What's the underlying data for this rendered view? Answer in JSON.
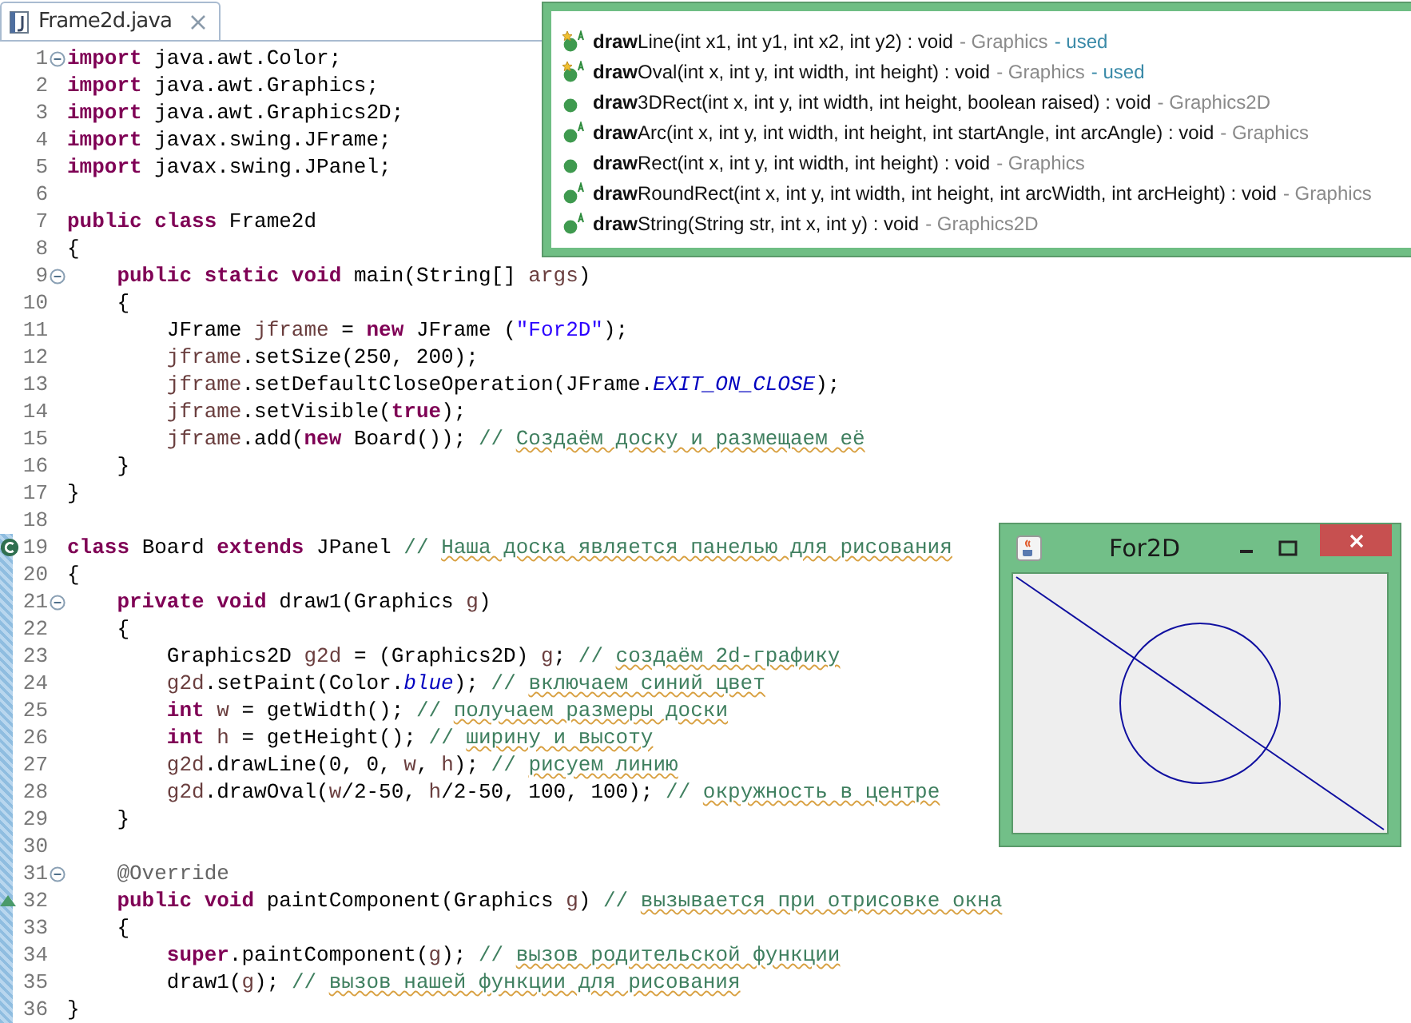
{
  "tab": {
    "label": "Frame2d.java",
    "selected": true
  },
  "lines": [
    {
      "number": "1",
      "kind": "fold",
      "range": false,
      "tokens": [
        {
          "kind": "kw",
          "text": "import"
        },
        {
          "kind": "p",
          "text": " java.awt.Color;"
        }
      ]
    },
    {
      "number": "2",
      "range": false,
      "tokens": [
        {
          "kind": "kw",
          "text": "import"
        },
        {
          "kind": "p",
          "text": " java.awt.Graphics;"
        }
      ]
    },
    {
      "number": "3",
      "range": false,
      "tokens": [
        {
          "kind": "kw",
          "text": "import"
        },
        {
          "kind": "p",
          "text": " java.awt.Graphics2D;"
        }
      ]
    },
    {
      "number": "4",
      "range": false,
      "tokens": [
        {
          "kind": "kw",
          "text": "import"
        },
        {
          "kind": "p",
          "text": " javax.swing.JFrame;"
        }
      ]
    },
    {
      "number": "5",
      "range": false,
      "tokens": [
        {
          "kind": "kw",
          "text": "import"
        },
        {
          "kind": "p",
          "text": " javax.swing.JPanel;"
        }
      ]
    },
    {
      "number": "6",
      "range": false
    },
    {
      "number": "7",
      "range": false,
      "tokens": [
        {
          "kind": "kw",
          "text": "public class"
        },
        {
          "kind": "p",
          "text": " Frame2d"
        }
      ]
    },
    {
      "number": "8",
      "range": false,
      "tokens": [
        {
          "kind": "p",
          "text": "{"
        }
      ]
    },
    {
      "number": "9",
      "kind": "fold",
      "range": false,
      "tokens": [
        {
          "kind": "kw",
          "text": "    public static void"
        },
        {
          "kind": "p",
          "text": " main(String[] "
        },
        {
          "kind": "v",
          "text": "args"
        },
        {
          "kind": "p",
          "text": ")"
        }
      ]
    },
    {
      "number": "10",
      "range": false,
      "tokens": [
        {
          "kind": "p",
          "text": "    {"
        }
      ]
    },
    {
      "number": "11",
      "range": false,
      "tokens": [
        {
          "kind": "p",
          "text": "        JFrame "
        },
        {
          "kind": "v",
          "text": "jframe"
        },
        {
          "kind": "p",
          "text": " = "
        },
        {
          "kind": "kw",
          "text": "new"
        },
        {
          "kind": "p",
          "text": " JFrame ("
        },
        {
          "kind": "s",
          "text": "\"For2D\""
        },
        {
          "kind": "p",
          "text": ");"
        }
      ]
    },
    {
      "number": "12",
      "range": false,
      "tokens": [
        {
          "kind": "v",
          "text": "        jframe"
        },
        {
          "kind": "p",
          "text": ".setSize(250, 200);"
        }
      ]
    },
    {
      "number": "13",
      "range": false,
      "tokens": [
        {
          "kind": "v",
          "text": "        jframe"
        },
        {
          "kind": "p",
          "text": ".setDefaultCloseOperation(JFrame."
        },
        {
          "kind": "c",
          "text": "EXIT_ON_CLOSE"
        },
        {
          "kind": "p",
          "text": ");"
        }
      ]
    },
    {
      "number": "14",
      "range": false,
      "tokens": [
        {
          "kind": "v",
          "text": "        jframe"
        },
        {
          "kind": "p",
          "text": ".setVisible("
        },
        {
          "kind": "kw",
          "text": "true"
        },
        {
          "kind": "p",
          "text": ");"
        }
      ]
    },
    {
      "number": "15",
      "range": false,
      "tokens": [
        {
          "kind": "v",
          "text": "        jframe"
        },
        {
          "kind": "p",
          "text": ".add("
        },
        {
          "kind": "kw",
          "text": "new"
        },
        {
          "kind": "p",
          "text": " Board()); "
        },
        {
          "kind": "cm",
          "text": "// "
        },
        {
          "kind": "sp",
          "text": "Создаём доску и размещаем её"
        }
      ]
    },
    {
      "number": "16",
      "range": false,
      "tokens": [
        {
          "kind": "p",
          "text": "    }"
        }
      ]
    },
    {
      "number": "17",
      "range": false,
      "tokens": [
        {
          "kind": "p",
          "text": "}"
        }
      ]
    },
    {
      "number": "18",
      "range": false
    },
    {
      "number": "19",
      "kind": "class",
      "range": true,
      "tokens": [
        {
          "kind": "kw",
          "text": "class"
        },
        {
          "kind": "p",
          "text": " Board "
        },
        {
          "kind": "kw",
          "text": "extends"
        },
        {
          "kind": "p",
          "text": " JPanel "
        },
        {
          "kind": "cm",
          "text": "// "
        },
        {
          "kind": "sp",
          "text": "Наша доска является панелью для рисования"
        }
      ]
    },
    {
      "number": "20",
      "range": true,
      "tokens": [
        {
          "kind": "p",
          "text": "{"
        }
      ]
    },
    {
      "number": "21",
      "kind": "fold",
      "range": true,
      "tokens": [
        {
          "kind": "kw",
          "text": "    private void"
        },
        {
          "kind": "p",
          "text": " draw1(Graphics "
        },
        {
          "kind": "v",
          "text": "g"
        },
        {
          "kind": "p",
          "text": ")"
        }
      ]
    },
    {
      "number": "22",
      "range": true,
      "tokens": [
        {
          "kind": "p",
          "text": "    {"
        }
      ]
    },
    {
      "number": "23",
      "range": true,
      "tokens": [
        {
          "kind": "p",
          "text": "        Graphics2D "
        },
        {
          "kind": "v",
          "text": "g2d"
        },
        {
          "kind": "p",
          "text": " = (Graphics2D) "
        },
        {
          "kind": "v",
          "text": "g"
        },
        {
          "kind": "p",
          "text": "; "
        },
        {
          "kind": "cm",
          "text": "// "
        },
        {
          "kind": "sp",
          "text": "создаём 2d-графику"
        }
      ]
    },
    {
      "number": "24",
      "range": true,
      "tokens": [
        {
          "kind": "v",
          "text": "        g2d"
        },
        {
          "kind": "p",
          "text": ".setPaint(Color."
        },
        {
          "kind": "c",
          "text": "blue"
        },
        {
          "kind": "p",
          "text": "); "
        },
        {
          "kind": "cm",
          "text": "// "
        },
        {
          "kind": "sp",
          "text": "включаем синий цвет"
        }
      ]
    },
    {
      "number": "25",
      "range": true,
      "tokens": [
        {
          "kind": "kw",
          "text": "        int"
        },
        {
          "kind": "v",
          "text": " w"
        },
        {
          "kind": "p",
          "text": " = getWidth(); "
        },
        {
          "kind": "cm",
          "text": "// "
        },
        {
          "kind": "sp",
          "text": "получаем размеры доски"
        }
      ]
    },
    {
      "number": "26",
      "range": true,
      "tokens": [
        {
          "kind": "kw",
          "text": "        int"
        },
        {
          "kind": "v",
          "text": " h"
        },
        {
          "kind": "p",
          "text": " = getHeight(); "
        },
        {
          "kind": "cm",
          "text": "// "
        },
        {
          "kind": "sp",
          "text": "ширину и высоту"
        }
      ]
    },
    {
      "number": "27",
      "range": true,
      "tokens": [
        {
          "kind": "v",
          "text": "        g2d"
        },
        {
          "kind": "p",
          "text": ".drawLine(0, 0, "
        },
        {
          "kind": "v",
          "text": "w"
        },
        {
          "kind": "p",
          "text": ", "
        },
        {
          "kind": "v",
          "text": "h"
        },
        {
          "kind": "p",
          "text": "); "
        },
        {
          "kind": "cm",
          "text": "// "
        },
        {
          "kind": "sp",
          "text": "рисуем линию"
        }
      ]
    },
    {
      "number": "28",
      "range": true,
      "tokens": [
        {
          "kind": "v",
          "text": "        g2d"
        },
        {
          "kind": "p",
          "text": ".drawOval("
        },
        {
          "kind": "v",
          "text": "w"
        },
        {
          "kind": "p",
          "text": "/2-50, "
        },
        {
          "kind": "v",
          "text": "h"
        },
        {
          "kind": "p",
          "text": "/2-50, 100, 100); "
        },
        {
          "kind": "cm",
          "text": "// "
        },
        {
          "kind": "sp",
          "text": "окружность в центре"
        }
      ]
    },
    {
      "number": "29",
      "range": true,
      "tokens": [
        {
          "kind": "p",
          "text": "    }"
        }
      ]
    },
    {
      "number": "30",
      "range": true
    },
    {
      "number": "31",
      "kind": "fold",
      "range": true,
      "tokens": [
        {
          "kind": "an",
          "text": "    @Override"
        }
      ]
    },
    {
      "number": "32",
      "kind": "override",
      "range": true,
      "tokens": [
        {
          "kind": "kw",
          "text": "    public void"
        },
        {
          "kind": "p",
          "text": " paintComponent(Graphics "
        },
        {
          "kind": "v",
          "text": "g"
        },
        {
          "kind": "p",
          "text": ") "
        },
        {
          "kind": "cm",
          "text": "// "
        },
        {
          "kind": "sp",
          "text": "вызывается при отрисовке окна"
        }
      ]
    },
    {
      "number": "33",
      "range": true,
      "tokens": [
        {
          "kind": "p",
          "text": "    {"
        }
      ]
    },
    {
      "number": "34",
      "range": true,
      "tokens": [
        {
          "kind": "kw",
          "text": "        super"
        },
        {
          "kind": "p",
          "text": ".paintComponent("
        },
        {
          "kind": "v",
          "text": "g"
        },
        {
          "kind": "p",
          "text": "); "
        },
        {
          "kind": "cm",
          "text": "// "
        },
        {
          "kind": "sp",
          "text": "вызов родительской функции"
        }
      ]
    },
    {
      "number": "35",
      "range": true,
      "tokens": [
        {
          "kind": "p",
          "text": "        draw1("
        },
        {
          "kind": "v",
          "text": "g"
        },
        {
          "kind": "p",
          "text": "); "
        },
        {
          "kind": "cm",
          "text": "// "
        },
        {
          "kind": "sp",
          "text": "вызов нашей функции для рисования"
        }
      ]
    },
    {
      "number": "36",
      "range": true,
      "tokens": [
        {
          "kind": "p",
          "text": "}"
        }
      ]
    }
  ],
  "completions": [
    {
      "kind": "used",
      "signature": "**draw**Line(int x1, int y1, int x2, int y2) : void",
      "owner": "- Graphics",
      "tag": "- used"
    },
    {
      "kind": "used",
      "signature": "**draw**Oval(int x, int y, int width, int height) : void",
      "owner": "- Graphics",
      "tag": "- used"
    },
    {
      "kind": "public",
      "signature": "**draw**3DRect(int x, int y, int width, int height, boolean raised) : void",
      "owner": "- Graphics2D"
    },
    {
      "kind": "abstract",
      "signature": "**draw**Arc(int x, int y, int width, int height, int startAngle, int arcAngle) : void",
      "owner": "- Graphics"
    },
    {
      "kind": "public",
      "signature": "**draw**Rect(int x, int y, int width, int height) : void",
      "owner": "- Graphics"
    },
    {
      "kind": "abstract",
      "signature": "**draw**RoundRect(int x, int y, int width, int height, int arcWidth, int arcHeight) : void",
      "owner": "- Graphics"
    },
    {
      "kind": "abstract",
      "signature": "**draw**String(String str, int x, int y) : void",
      "owner": "- Graphics2D"
    }
  ],
  "app_window": {
    "title": "For2D"
  }
}
